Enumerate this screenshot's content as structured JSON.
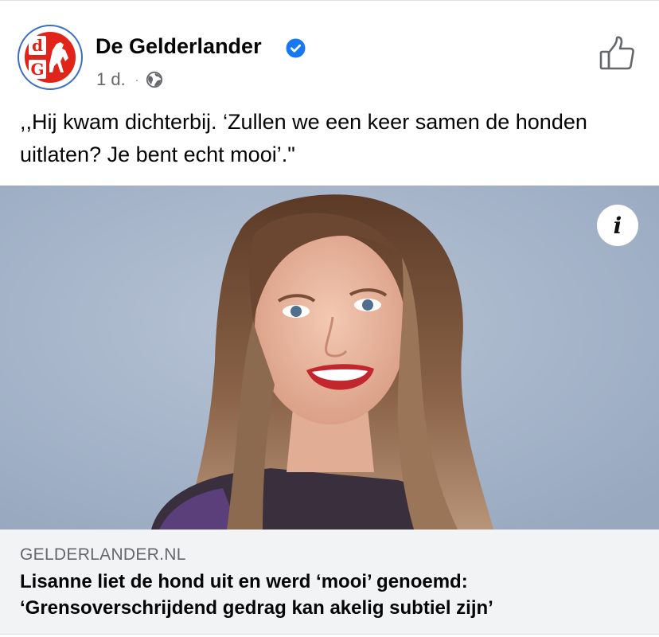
{
  "post": {
    "page_name": "De Gelderlander",
    "timestamp": "1 d.",
    "separator": "·",
    "message": ",,Hij kwam dichterbij. ‘Zullen we een keer samen de honden uitlaten? Je bent echt mooi’.\"",
    "avatar_letters": {
      "top": "d",
      "bottom": "G"
    }
  },
  "link": {
    "domain": "GELDERLANDER.NL",
    "title_line1": "Lisanne liet de hond uit en werd ‘mooi’ genoemd:",
    "title_line2": "‘Grensoverschrijdend gedrag kan akelig subtiel zijn’"
  },
  "info_button": {
    "label": "i"
  },
  "icons": {
    "verified": "verified-badge-icon",
    "audience": "globe-icon",
    "like": "thumbs-up-icon",
    "info": "info-icon"
  },
  "colors": {
    "verified_blue": "#1877f2",
    "brand_red": "#e2231a",
    "secondary_text": "#65676b",
    "link_card_bg": "#f2f3f5"
  }
}
